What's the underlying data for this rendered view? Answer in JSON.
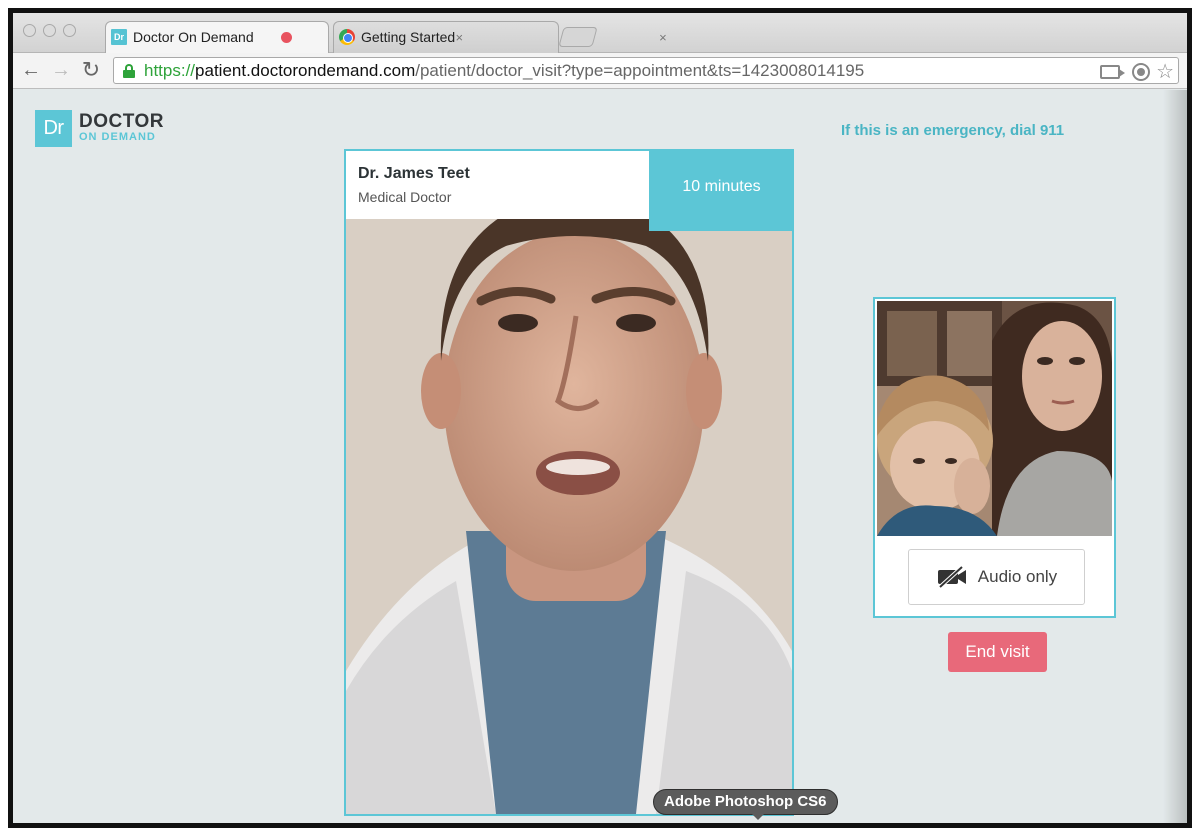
{
  "browser": {
    "tabs": [
      {
        "label": "Doctor On Demand",
        "favicon": "Dr",
        "active": true
      },
      {
        "label": "Getting Started",
        "active": false
      }
    ],
    "close_glyph": "×",
    "address": {
      "scheme": "https://",
      "host": "patient.doctorondemand.com",
      "path": "/patient/doctor_visit?type=appointment&ts=1423008014195"
    },
    "nav": {
      "back": "←",
      "forward": "→",
      "reload": "↻"
    },
    "star_glyph": "☆"
  },
  "page": {
    "logo": {
      "mark": "Dr",
      "word1": "DOCTOR",
      "word2": "ON DEMAND"
    },
    "emergency_text": "If this is an emergency, dial 911",
    "doctor": {
      "name": "Dr. James Teet",
      "title": "Medical Doctor"
    },
    "timer": "10 minutes",
    "audio_only_label": "Audio only",
    "end_visit_label": "End visit"
  },
  "os_tooltip": "Adobe Photoshop CS6",
  "colors": {
    "brand_teal": "#5cc6d6",
    "end_visit": "#e8697a",
    "page_bg": "#e3e9ea",
    "secure_green": "#2ea33a"
  }
}
